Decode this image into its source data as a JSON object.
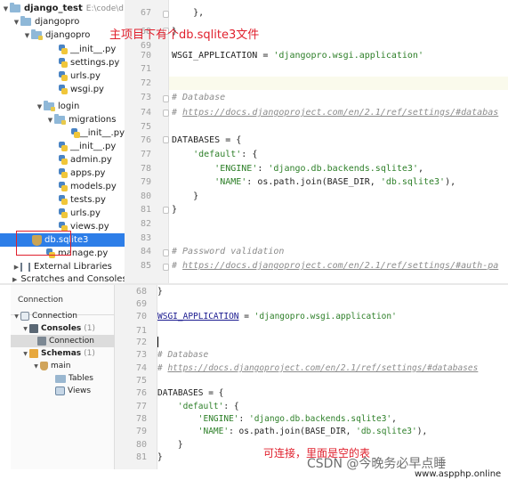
{
  "top_panel": {
    "project_tree": {
      "root": {
        "name": "django_test",
        "path": "E:\\code\\d"
      },
      "items": [
        {
          "label": "djangopro"
        },
        {
          "label": "djangopro"
        },
        {
          "label": "__init__.py"
        },
        {
          "label": "settings.py"
        },
        {
          "label": "urls.py"
        },
        {
          "label": "wsgi.py"
        },
        {
          "label": "login"
        },
        {
          "label": "migrations"
        },
        {
          "label": "__init__.py"
        },
        {
          "label": "__init__.py"
        },
        {
          "label": "admin.py"
        },
        {
          "label": "apps.py"
        },
        {
          "label": "models.py"
        },
        {
          "label": "tests.py"
        },
        {
          "label": "urls.py"
        },
        {
          "label": "views.py"
        },
        {
          "label": "db.sqlite3"
        },
        {
          "label": "manage.py"
        },
        {
          "label": "External Libraries"
        },
        {
          "label": "Scratches and Consoles"
        }
      ]
    },
    "line_numbers": [
      "67",
      "68",
      "69",
      "70",
      "71",
      "72",
      "73",
      "74",
      "75",
      "76",
      "77",
      "78",
      "79",
      "80",
      "81",
      "82",
      "83",
      "84",
      "85"
    ],
    "code_lines": {
      "l67": "    },",
      "l68": "}",
      "l70": "WSGI_APPLICATION = ",
      "l70s": "'djangopro.wsgi.application'",
      "l73": "# Database",
      "l74a": "# ",
      "l74b": "https://docs.djangoproject.com/en/2.1/ref/settings/#databas",
      "l76": "DATABASES = {",
      "l77a": "    ",
      "l77b": "'default'",
      "l77c": ": {",
      "l78a": "        ",
      "l78b": "'ENGINE'",
      "l78c": ": ",
      "l78d": "'django.db.backends.sqlite3'",
      "l78e": ",",
      "l79a": "        ",
      "l79b": "'NAME'",
      "l79c": ": os.path.join(BASE_DIR, ",
      "l79d": "'db.sqlite3'",
      "l79e": "),",
      "l80": "    }",
      "l81": "}",
      "l84": "# Password validation",
      "l85a": "# ",
      "l85b": "https://docs.djangoproject.com/en/2.1/ref/settings/#auth-pa"
    },
    "annotation": "主项目下有个db.sqlite3文件"
  },
  "bottom_panel": {
    "db_tool": {
      "header": "Connection",
      "items": [
        {
          "label": "Connection"
        },
        {
          "label": "Consoles",
          "count": "(1)"
        },
        {
          "label": "Connection"
        },
        {
          "label": "Schemas",
          "count": "(1)"
        },
        {
          "label": "main"
        },
        {
          "label": "Tables"
        },
        {
          "label": "Views"
        }
      ]
    },
    "line_numbers": [
      "68",
      "69",
      "70",
      "71",
      "72",
      "73",
      "74",
      "75",
      "76",
      "77",
      "78",
      "79",
      "80",
      "81"
    ],
    "code_lines": {
      "l68": "}",
      "l70a": "WSGI_APPLICATION",
      "l70b": " = ",
      "l70c": "'djangopro.wsgi.application'",
      "l73": "# Database",
      "l74a": "# ",
      "l74b": "https://docs.djangoproject.com/en/2.1/ref/settings/#databases",
      "l76": "DATABASES = {",
      "l77a": "    ",
      "l77b": "'default'",
      "l77c": ": {",
      "l78a": "        ",
      "l78b": "'ENGINE'",
      "l78c": ": ",
      "l78d": "'django.db.backends.sqlite3'",
      "l78e": ",",
      "l79a": "        ",
      "l79b": "'NAME'",
      "l79c": ": os.path.join(BASE_DIR, ",
      "l79d": "'db.sqlite3'",
      "l79e": "),",
      "l80": "    }",
      "l81": "}"
    },
    "annotation": "可连接，里面是空的表",
    "watermark": "CSDN @今晚务必早点睡",
    "site": "www.aspphp.online"
  },
  "colors": {
    "selection": "#2d7ee8",
    "annotation_red": "#e0202d",
    "string_green": "#2d7f28",
    "comment_gray": "#8c8c8c"
  }
}
